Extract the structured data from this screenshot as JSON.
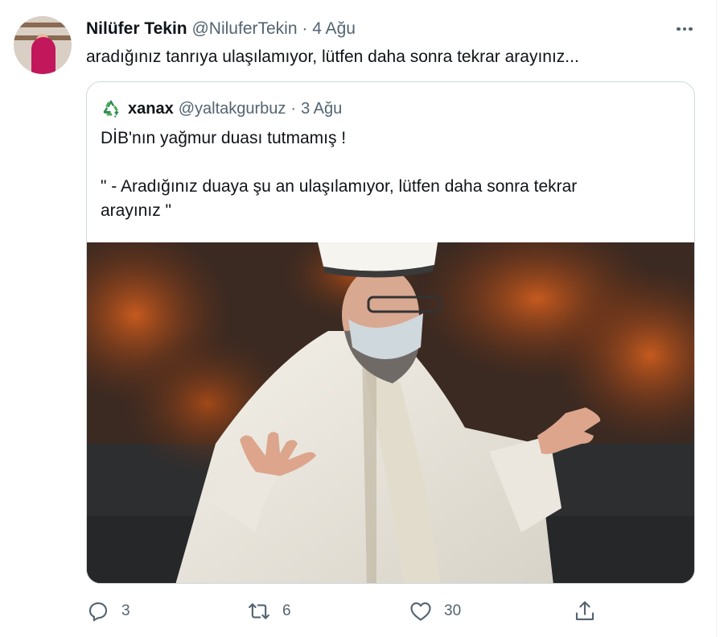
{
  "tweet": {
    "author_name": "Nilüfer Tekin",
    "author_handle": "@NiluferTekin",
    "separator": "·",
    "date": "4 Ağu",
    "text": "aradığınız tanrıya ulaşılamıyor, lütfen daha sonra tekrar arayınız...",
    "avatar_icon": "profile-photo"
  },
  "quoted_tweet": {
    "author_icon": "recycle-icon",
    "author_name": "xanax",
    "author_handle": "@yaltakgurbuz",
    "separator": "·",
    "date": "3 Ağu",
    "lines": [
      "DİB'nın yağmur duası tutmamış !",
      "\" - Aradığınız duaya şu an ulaşılamıyor, lütfen daha sonra tekrar",
      "arayınız \""
    ]
  },
  "actions": {
    "reply_count": "3",
    "retweet_count": "6",
    "like_count": "30"
  },
  "colors": {
    "text": "#0f1419",
    "secondary": "#536471",
    "border": "#cfd9de"
  }
}
